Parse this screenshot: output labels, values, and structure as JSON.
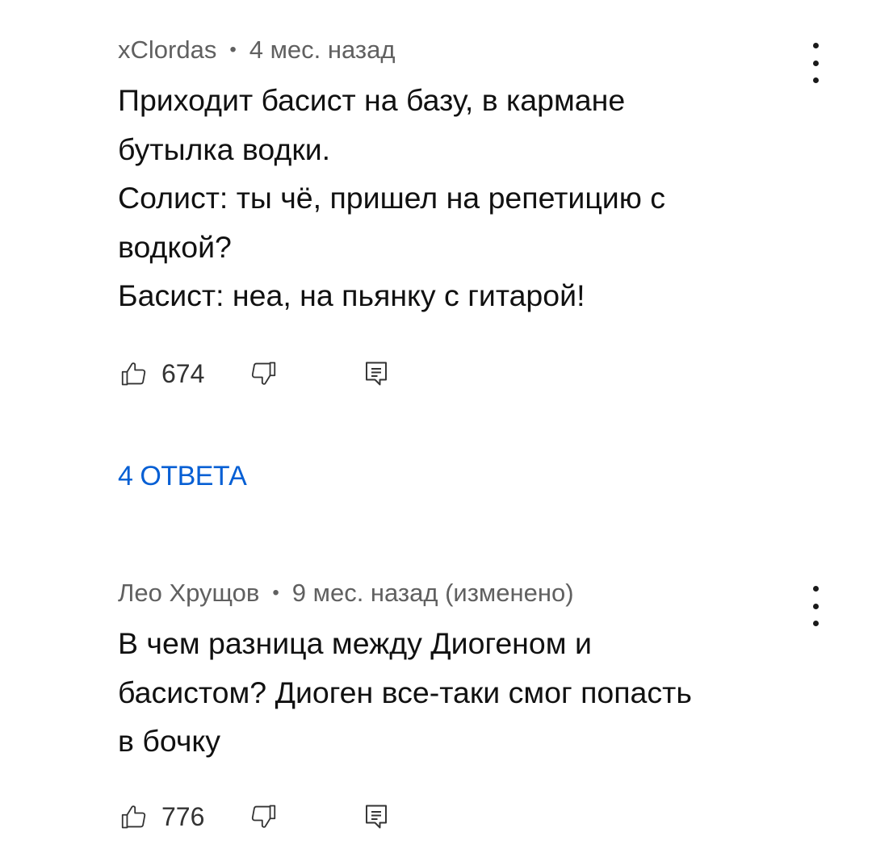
{
  "comments": [
    {
      "author": "xClordas",
      "separator": "•",
      "time": "4 мес. назад",
      "text": "Приходит басист на базу, в кармане\nбутылка водки.\nСолист: ты чё, пришел на репетицию с\nводкой?\nБасист: неа, на пьянку с гитарой!",
      "likes": "674",
      "replies_label": "4 ОТВЕТА"
    },
    {
      "author": "Лео Хрущов",
      "separator": "•",
      "time": "9 мес. назад (изменено)",
      "text": "В чем разница между Диогеном и\nбасистом? Диоген все-таки смог попасть\nв бочку",
      "likes": "776"
    }
  ],
  "icons": {
    "like": "thumb-up-icon",
    "dislike": "thumb-down-icon",
    "reply": "reply-comment-icon",
    "more": "more-vert-icon"
  },
  "colors": {
    "link": "#065fd4",
    "meta": "#606060",
    "text": "#111111"
  }
}
